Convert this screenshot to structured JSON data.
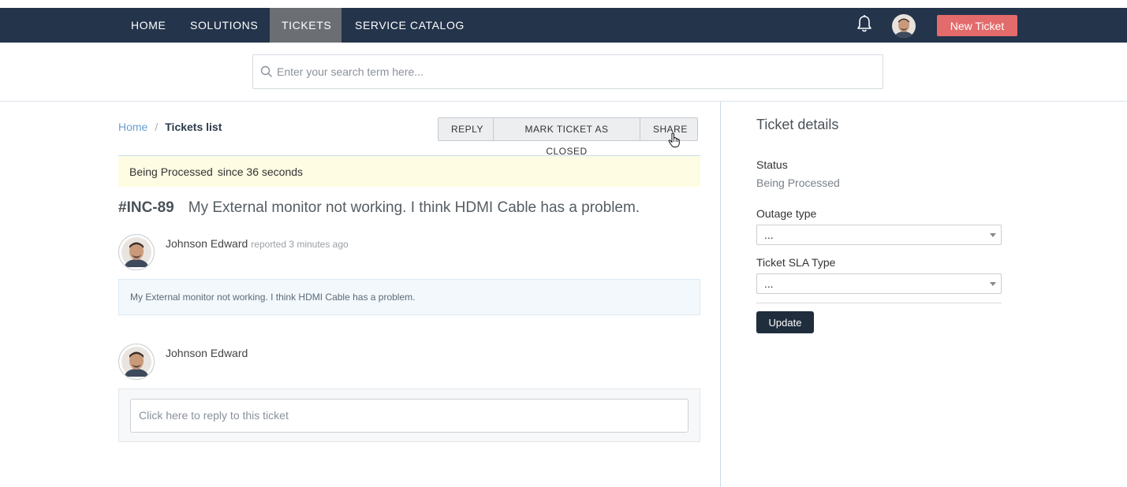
{
  "nav": {
    "items": [
      {
        "label": "HOME",
        "active": false
      },
      {
        "label": "SOLUTIONS",
        "active": false
      },
      {
        "label": "TICKETS",
        "active": true
      },
      {
        "label": "SERVICE CATALOG",
        "active": false
      }
    ],
    "bell_icon": "bell-icon",
    "new_ticket_label": "New Ticket",
    "new_ticket_color": "#e36b6b",
    "bar_color": "#23344b"
  },
  "search": {
    "placeholder": "Enter your search term here...",
    "value": ""
  },
  "breadcrumb": {
    "home": "Home",
    "separator": "/",
    "current": "Tickets list"
  },
  "actions": {
    "reply": "REPLY",
    "close": "MARK TICKET AS CLOSED",
    "share": "SHARE"
  },
  "status_banner": {
    "status": "Being Processed",
    "since": "since 36 seconds"
  },
  "ticket": {
    "id": "#INC-89",
    "subject": "My External monitor not working. I think HDMI Cable has a problem."
  },
  "conversation": {
    "reporter": "Johnson Edward",
    "reported_text": "reported 3 minutes ago",
    "message": "My External monitor not working. I think HDMI Cable has a problem.",
    "replier": "Johnson Edward",
    "reply_placeholder": "Click here to reply to this ticket"
  },
  "details": {
    "title": "Ticket details",
    "status_label": "Status",
    "status_value": "Being Processed",
    "outage_label": "Outage type",
    "outage_value": "...",
    "sla_label": "Ticket SLA Type",
    "sla_value": "...",
    "update_label": "Update"
  }
}
